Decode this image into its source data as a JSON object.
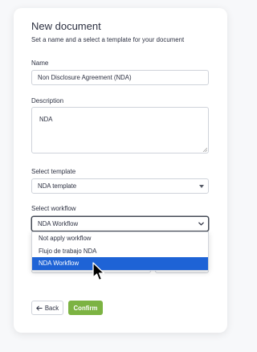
{
  "form": {
    "title": "New document",
    "subtitle": "Set a name and a select a template for your document",
    "name_label": "Name",
    "name_value": "Non Disclosure Agreement (NDA)",
    "description_label": "Description",
    "description_value": "NDA",
    "template_label": "Select template",
    "template_value": "NDA template",
    "workflow_label": "Select workflow",
    "workflow_value": "NDA Workflow"
  },
  "workflow_options": [
    {
      "label": "Not apply workflow"
    },
    {
      "label": "Flujo de trabajo NDA"
    },
    {
      "label": "NDA Workflow"
    }
  ],
  "selected_option": "NDA Workflow",
  "buttons": {
    "back_label": "Back",
    "confirm_label": "Confirm"
  },
  "colors": {
    "accent": "#7cb342",
    "selection": "#1e63d6",
    "text": "#2d3142"
  },
  "icons": {
    "back": "arrow-left-icon",
    "cursor": "mouse-pointer-icon"
  }
}
